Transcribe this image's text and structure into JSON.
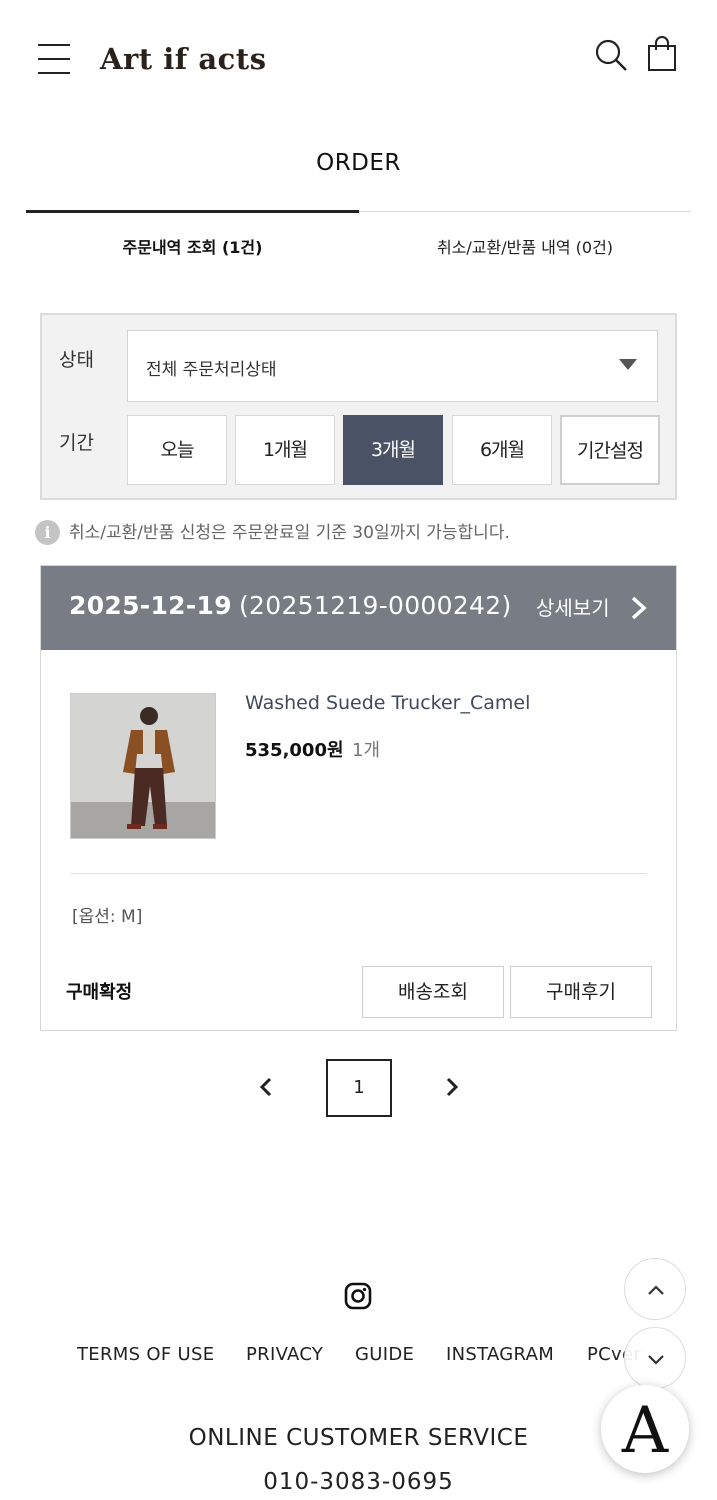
{
  "header": {
    "logo": "Art if acts",
    "icons": [
      "menu-icon",
      "search-icon",
      "shopping-bag-icon"
    ]
  },
  "page": {
    "title": "ORDER"
  },
  "tabs": [
    {
      "label": "주문내역 조회 (1건)",
      "active": true
    },
    {
      "label": "취소/교환/반품 내역 (0건)",
      "active": false
    }
  ],
  "filter": {
    "status_label": "상태",
    "status_value": "전체 주문처리상태",
    "period_label": "기간",
    "periods": [
      "오늘",
      "1개월",
      "3개월",
      "6개월",
      "기간설정"
    ],
    "active_period": "3개월"
  },
  "notice": "취소/교환/반품 신청은 주문완료일 기준 30일까지 가능합니다.",
  "order": {
    "date": "2025-12-19",
    "number": "(20251219-0000242)",
    "detail_label": "상세보기",
    "product": {
      "name": "Washed Suede Trucker_Camel",
      "price": "535,000원",
      "quantity": "1개",
      "option": "[옵션: M]"
    },
    "status": "구매확정",
    "buttons": {
      "tracking": "배송조회",
      "review": "구매후기"
    }
  },
  "pagination": {
    "current": "1"
  },
  "footer": {
    "links": [
      "TERMS OF USE",
      "PRIVACY",
      "GUIDE",
      "INSTAGRAM",
      "PCver"
    ],
    "cs_title": "ONLINE CUSTOMER SERVICE",
    "cs_phone": "010-3083-0695",
    "badge_letter": "A"
  },
  "colors": {
    "accent_dark": "#4a5265",
    "order_header_bg": "#777c85",
    "product_name": "#3f4a5c"
  }
}
